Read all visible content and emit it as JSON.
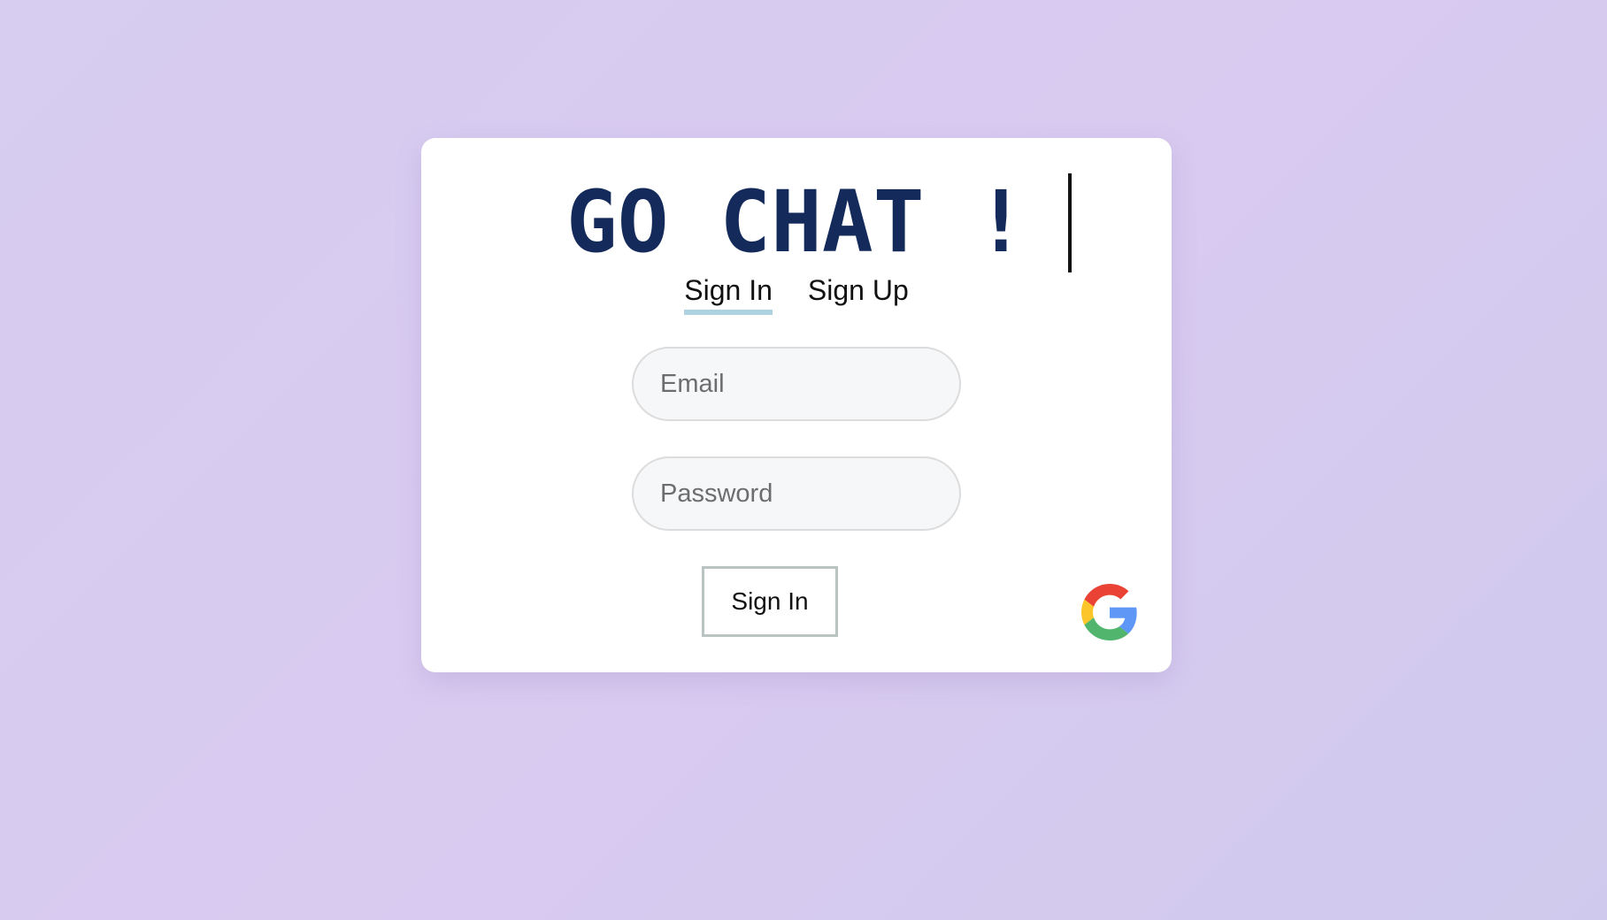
{
  "app": {
    "title": "GO CHAT !"
  },
  "tabs": [
    {
      "label": "Sign In",
      "active": true
    },
    {
      "label": "Sign Up",
      "active": false
    }
  ],
  "form": {
    "email_placeholder": "Email",
    "email_value": "",
    "password_placeholder": "Password",
    "password_value": "",
    "submit_label": "Sign In"
  },
  "social": {
    "google_icon": "google-icon"
  },
  "colors": {
    "title": "#142a5a",
    "active_tab_underline": "#aed3e0",
    "background_start": "#d6cdf0",
    "background_end": "#cfcaed"
  }
}
